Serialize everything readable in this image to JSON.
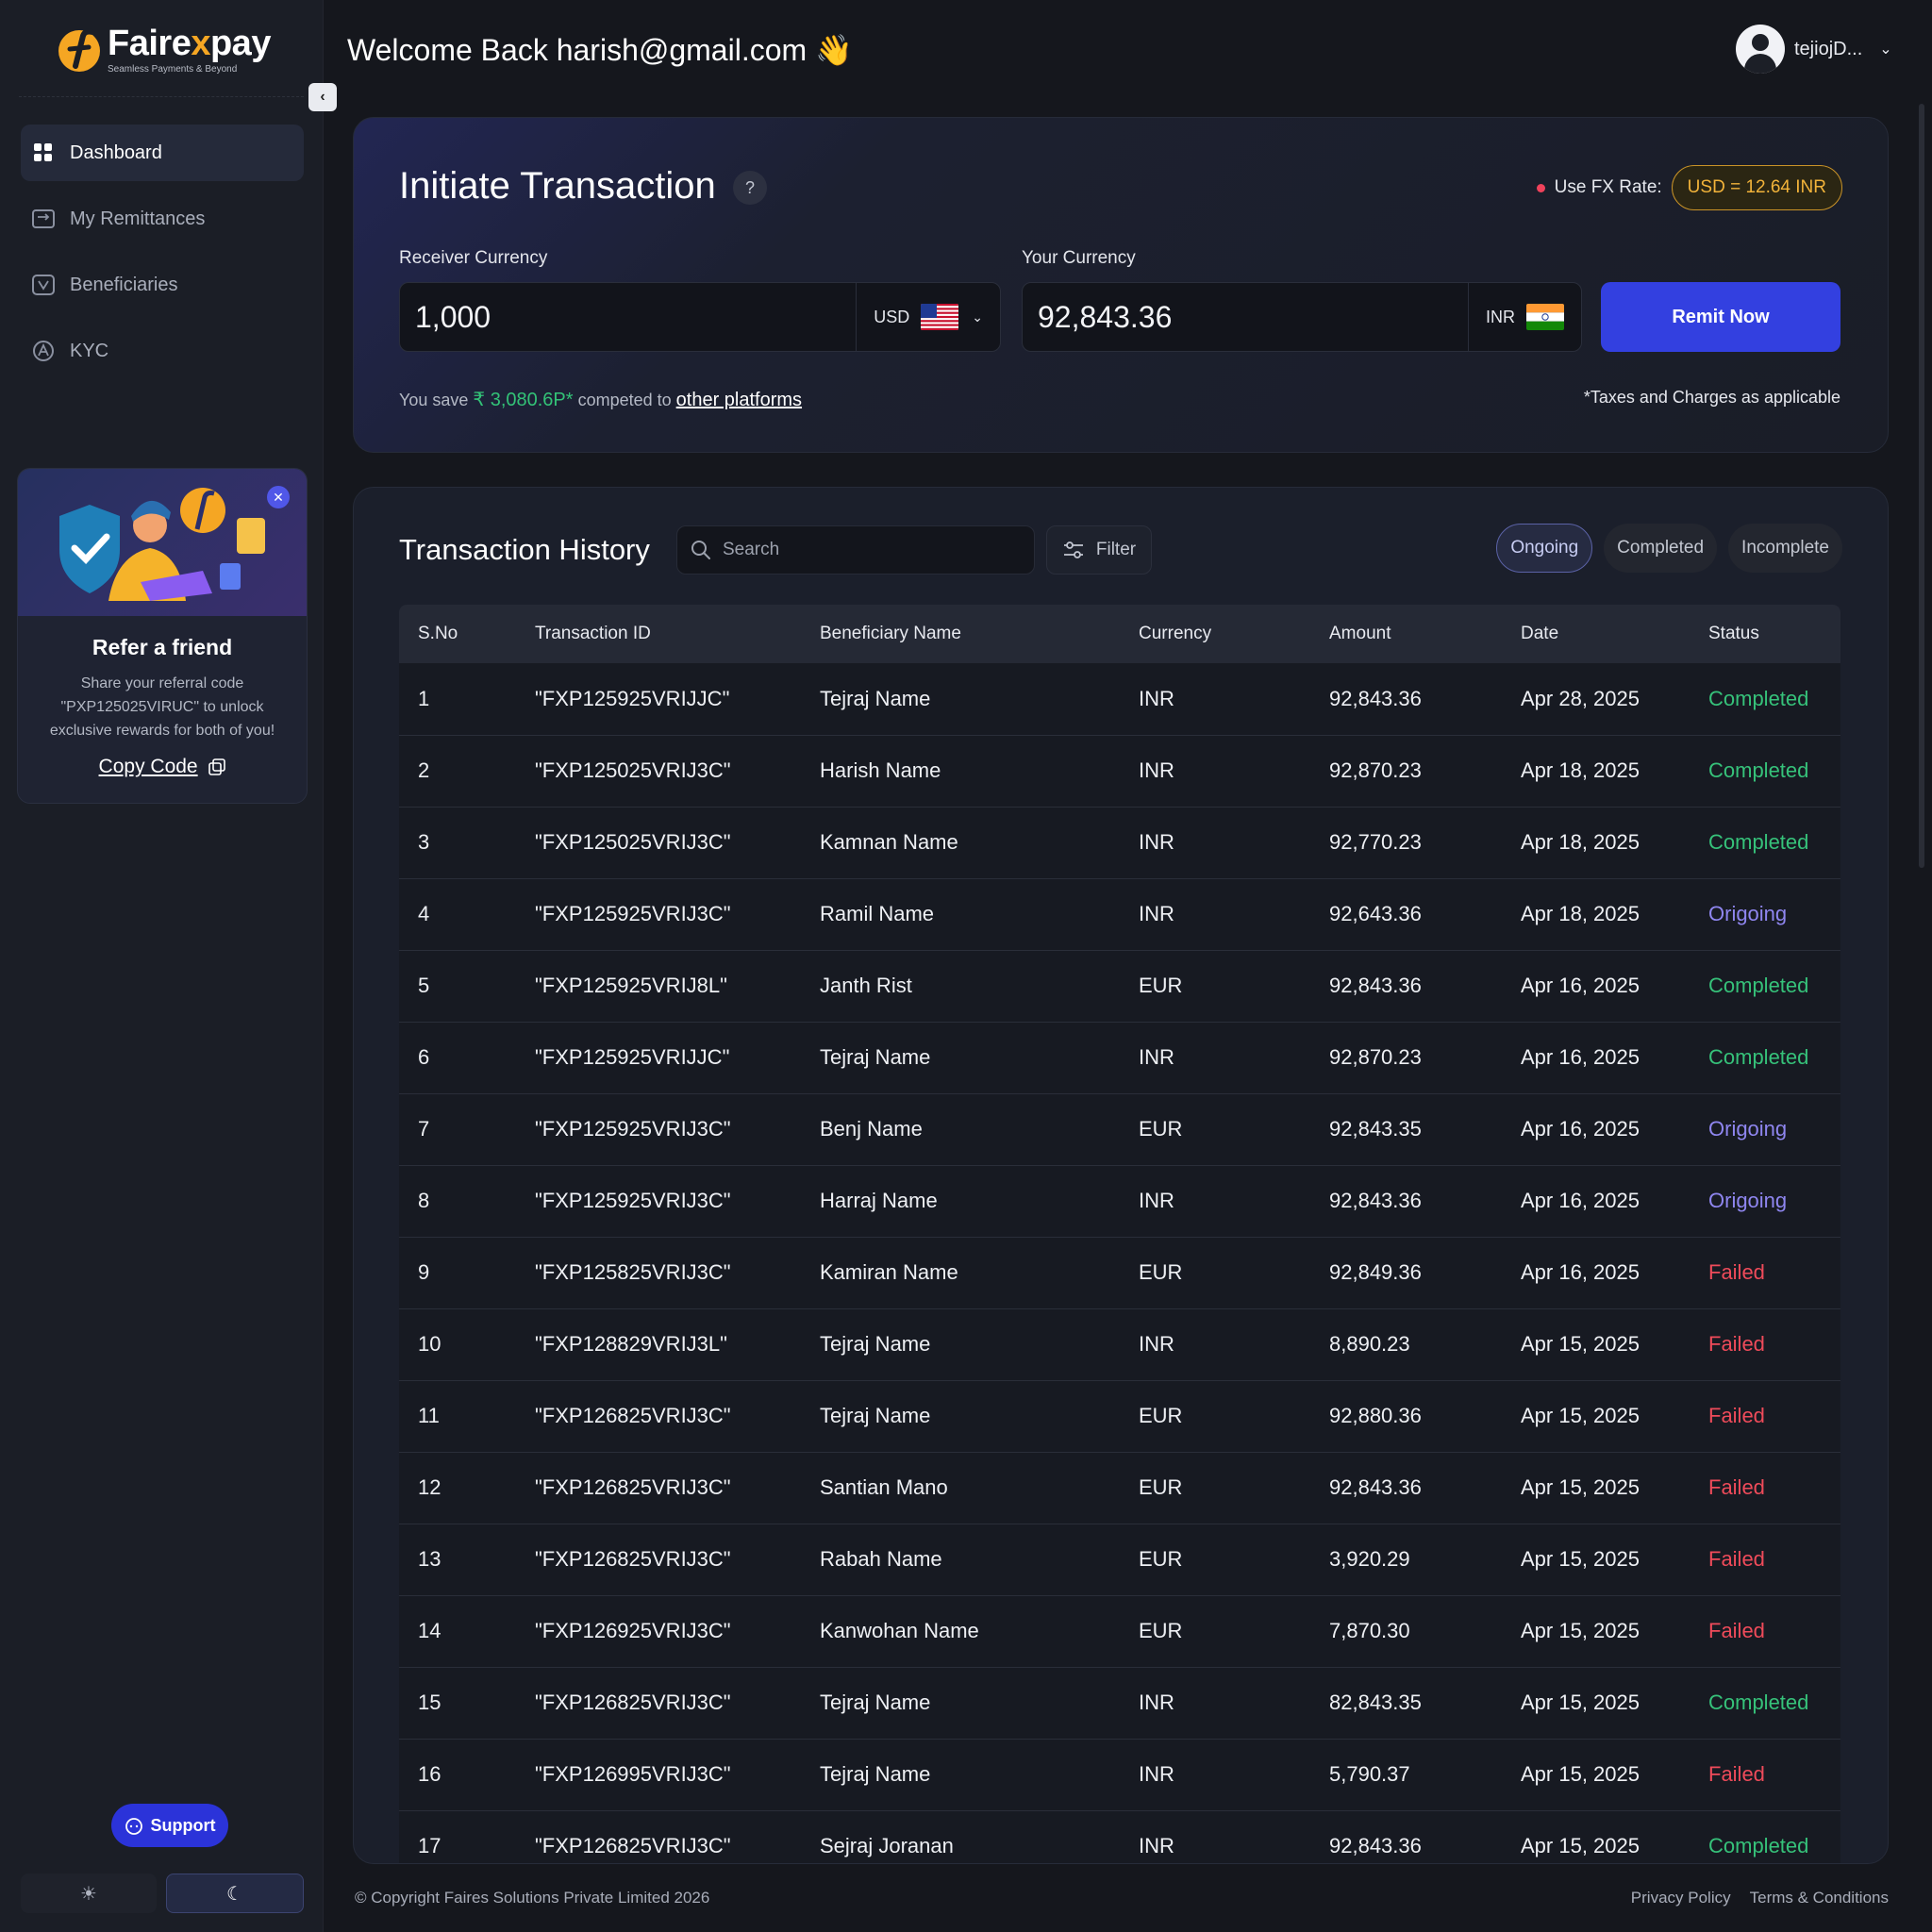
{
  "brand": {
    "name_part1": "Faire",
    "name_accent": "x",
    "name_part2": "pay",
    "tagline": "Seamless Payments & Beyond"
  },
  "sidebar": {
    "items": [
      {
        "label": "Dashboard",
        "icon": "grid-icon",
        "active": true
      },
      {
        "label": "My Remittances",
        "icon": "transfer-icon",
        "active": false
      },
      {
        "label": "Beneficiaries",
        "icon": "user-card-icon",
        "active": false
      },
      {
        "label": "KYC",
        "icon": "kyc-icon",
        "active": false
      }
    ],
    "promo": {
      "title": "Refer a friend",
      "description": "Share your referral code \"PXP125025VIRUC\" to unlock exclusive rewards for both of you!",
      "copy_label": "Copy Code"
    },
    "support_label": "Support",
    "theme": {
      "light": "☀",
      "dark": "☾"
    }
  },
  "header": {
    "welcome": "Welcome Back harish@gmail.com 👋",
    "user_name": "tejiojD..."
  },
  "initiate": {
    "title": "Initiate Transaction",
    "help": "?",
    "fx_label": "Use FX Rate:",
    "fx_rate": "USD = 12.64 INR",
    "receiver_label": "Receiver Currency",
    "receiver_value": "1,000",
    "receiver_currency": "USD",
    "your_label": "Your Currency",
    "your_value": "92,843.36",
    "your_currency": "INR",
    "remit_label": "Remit Now",
    "save_prefix": "You save",
    "save_amount": "₹ 3,080.6P*",
    "save_mid": "competed to",
    "save_link": "other platforms",
    "tax_note": "*Taxes and Charges as applicable"
  },
  "history": {
    "title": "Transaction History",
    "search_placeholder": "Search",
    "filter_label": "Filter",
    "tabs": [
      "Ongoing",
      "Completed",
      "Incomplete"
    ],
    "active_tab": "Ongoing",
    "columns": [
      "S.No",
      "Transaction ID",
      "Beneficiary Name",
      "Currency",
      "Amount",
      "Date",
      "Status"
    ],
    "rows": [
      [
        "1",
        "\"FXP125925VRIJJC\"",
        "Tejraj Name",
        "INR",
        "92,843.36",
        "Apr 28, 2025",
        "Completed"
      ],
      [
        "2",
        "\"FXP125025VRIJ3C\"",
        "Harish Name",
        "INR",
        "92,870.23",
        "Apr 18, 2025",
        "Completed"
      ],
      [
        "3",
        "\"FXP125025VRIJ3C\"",
        "Kamnan Name",
        "INR",
        "92,770.23",
        "Apr 18, 2025",
        "Completed"
      ],
      [
        "4",
        "\"FXP125925VRIJ3C\"",
        "Ramil Name",
        "INR",
        "92,643.36",
        "Apr 18, 2025",
        "Origoing"
      ],
      [
        "5",
        "\"FXP125925VRIJ8L\"",
        "Janth Rist",
        "EUR",
        "92,843.36",
        "Apr 16, 2025",
        "Completed"
      ],
      [
        "6",
        "\"FXP125925VRIJJC\"",
        "Tejraj Name",
        "INR",
        "92,870.23",
        "Apr 16, 2025",
        "Completed"
      ],
      [
        "7",
        "\"FXP125925VRIJ3C\"",
        "Benj Name",
        "EUR",
        "92,843.35",
        "Apr 16, 2025",
        "Origoing"
      ],
      [
        "8",
        "\"FXP125925VRIJ3C\"",
        "Harraj Name",
        "INR",
        "92,843.36",
        "Apr 16, 2025",
        "Origoing"
      ],
      [
        "9",
        "\"FXP125825VRIJ3C\"",
        "Kamiran Name",
        "EUR",
        "92,849.36",
        "Apr 16, 2025",
        "Failed"
      ],
      [
        "10",
        "\"FXP128829VRIJ3L\"",
        "Tejraj Name",
        "INR",
        "8,890.23",
        "Apr 15, 2025",
        "Failed"
      ],
      [
        "11",
        "\"FXP126825VRIJ3C\"",
        "Tejraj Name",
        "EUR",
        "92,880.36",
        "Apr 15, 2025",
        "Failed"
      ],
      [
        "12",
        "\"FXP126825VRIJ3C\"",
        "Santian Mano",
        "EUR",
        "92,843.36",
        "Apr 15, 2025",
        "Failed"
      ],
      [
        "13",
        "\"FXP126825VRIJ3C\"",
        "Rabah Name",
        "EUR",
        "3,920.29",
        "Apr 15, 2025",
        "Failed"
      ],
      [
        "14",
        "\"FXP126925VRIJ3C\"",
        "Kanwohan Name",
        "EUR",
        "7,870.30",
        "Apr 15, 2025",
        "Failed"
      ],
      [
        "15",
        "\"FXP126825VRIJ3C\"",
        "Tejraj Name",
        "INR",
        "82,843.35",
        "Apr 15, 2025",
        "Completed"
      ],
      [
        "16",
        "\"FXP126995VRIJ3C\"",
        "Tejraj Name",
        "INR",
        "5,790.37",
        "Apr 15, 2025",
        "Failed"
      ],
      [
        "17",
        "\"FXP126825VRIJ3C\"",
        "Sejraj Joranan",
        "INR",
        "92,843.36",
        "Apr 15, 2025",
        "Completed"
      ]
    ]
  },
  "footer": {
    "copyright": "© Copyright Faires Solutions Private Limited 2026",
    "privacy": "Privacy Policy",
    "terms": "Terms & Conditions"
  },
  "colors": {
    "accent": "#3340e0",
    "completed": "#36c27a",
    "ongoing": "#8f86f0",
    "failed": "#ef4b5a",
    "fx": "#f2b33a"
  }
}
